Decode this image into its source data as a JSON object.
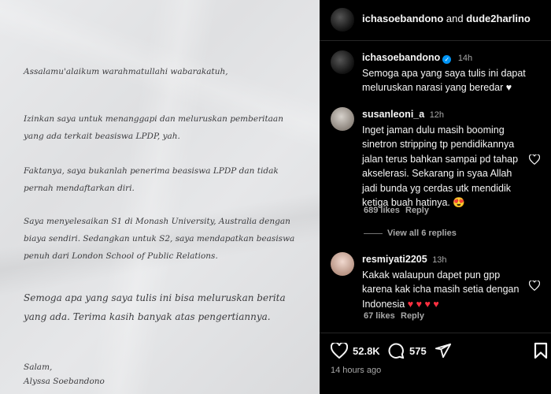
{
  "letter": {
    "greeting": "Assalamu'alaikum warahmatullahi wabarakatuh,",
    "p1": "Izinkan saya untuk menanggapi dan meluruskan pemberitaan yang ada terkait beasiswa LPDP, yah.",
    "p2": "Faktanya, saya bukanlah penerima beasiswa LPDP dan tidak pernah mendaftarkan diri.",
    "p3": "Saya menyelesaikan S1 di Monash University, Australia dengan biaya sendiri. Sedangkan untuk S2, saya mendapatkan beasiswa penuh dari London School of Public Relations.",
    "p4": "Semoga apa yang saya tulis ini bisa meluruskan berita yang ada. Terima kasih banyak atas pengertiannya.",
    "closing": "Salam,",
    "signature": "Alyssa Soebandono"
  },
  "header": {
    "user1": "ichasoebandono",
    "and": " and ",
    "user2": "dude2harlino"
  },
  "caption": {
    "username": "ichasoebandono",
    "time": "14h",
    "text": "Semoga apa yang saya tulis ini dapat meluruskan narasi yang beredar ♥"
  },
  "comments": [
    {
      "username": "susanleoni_a",
      "time": "12h",
      "text": "Inget jaman dulu masih booming sinetron stripping tp pendidikannya jalan terus bahkan sampai pd tahap akselerasi. Sekarang in syaa Allah jadi bunda yg cerdas utk mendidik ketiga buah hatinya. 😍",
      "likes": "689 likes",
      "reply": "Reply",
      "view_replies": "View all 6 replies"
    },
    {
      "username": "resmiyati2205",
      "time": "13h",
      "text": "Kakak walaupun dapet pun gpp karena kak icha masih setia dengan Indonesia",
      "hearts": "♥ ♥ ♥ ♥",
      "likes": "67 likes",
      "reply": "Reply"
    }
  ],
  "actions": {
    "likes_count": "52.8K",
    "comments_count": "575",
    "timestamp": "14 hours ago"
  }
}
